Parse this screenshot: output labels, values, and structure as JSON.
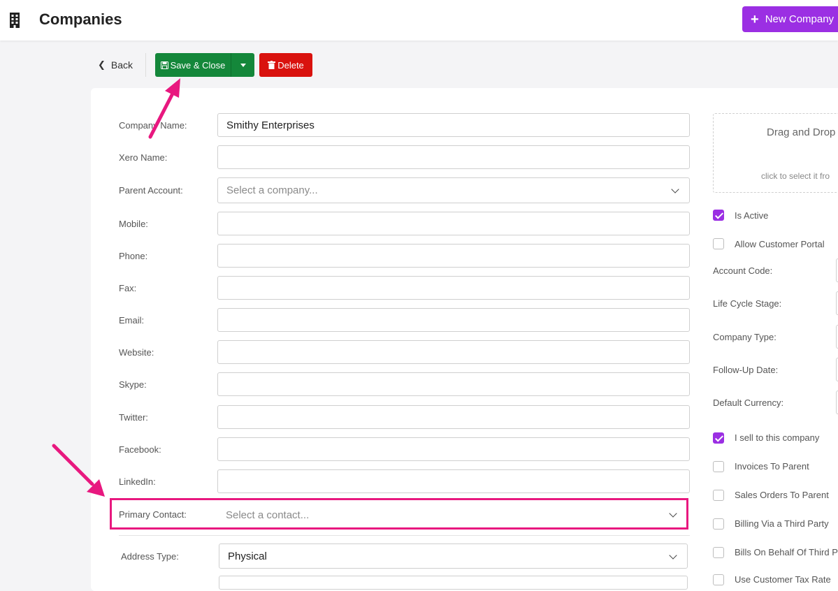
{
  "header": {
    "title": "Companies",
    "new_button_label": "New Company",
    "new_button_icon": "plus-icon",
    "brand_color": "#9b2fe3"
  },
  "toolbar": {
    "back_label": "Back",
    "save_label": "Save & Close",
    "delete_label": "Delete",
    "save_color": "#14873a",
    "delete_color": "#d9120e"
  },
  "form": {
    "company_name": {
      "label": "Company Name:",
      "value": "Smithy Enterprises"
    },
    "xero_name": {
      "label": "Xero Name:",
      "value": ""
    },
    "parent_account": {
      "label": "Parent Account:",
      "placeholder": "Select a company..."
    },
    "mobile": {
      "label": "Mobile:",
      "value": ""
    },
    "phone": {
      "label": "Phone:",
      "value": ""
    },
    "fax": {
      "label": "Fax:",
      "value": ""
    },
    "email": {
      "label": "Email:",
      "value": ""
    },
    "website": {
      "label": "Website:",
      "value": ""
    },
    "skype": {
      "label": "Skype:",
      "value": ""
    },
    "twitter": {
      "label": "Twitter:",
      "value": ""
    },
    "facebook": {
      "label": "Facebook:",
      "value": ""
    },
    "linkedin": {
      "label": "LinkedIn:",
      "value": ""
    },
    "primary_contact": {
      "label": "Primary Contact:",
      "placeholder": "Select a contact..."
    },
    "address_type": {
      "label": "Address Type:",
      "value": "Physical"
    }
  },
  "dropzone": {
    "title": "Drag and Drop",
    "subtitle": "click to select it fro"
  },
  "right_panel": {
    "is_active": {
      "label": "Is Active",
      "checked": true
    },
    "allow_portal": {
      "label": "Allow Customer Portal",
      "checked": false
    },
    "account_code": {
      "label": "Account Code:"
    },
    "life_cycle": {
      "label": "Life Cycle Stage:"
    },
    "company_type": {
      "label": "Company Type:"
    },
    "follow_up": {
      "label": "Follow-Up Date:"
    },
    "currency": {
      "label": "Default Currency:"
    },
    "sell_to": {
      "label": "I sell to this company",
      "checked": true
    },
    "invoices_parent": {
      "label": "Invoices To Parent",
      "checked": false
    },
    "sales_orders_parent": {
      "label": "Sales Orders To Parent",
      "checked": false
    },
    "billing_third": {
      "label": "Billing Via a Third Party",
      "checked": false
    },
    "bills_behalf": {
      "label": "Bills On Behalf Of Third Pa",
      "checked": false
    },
    "use_tax": {
      "label": "Use Customer Tax Rate",
      "checked": false
    }
  },
  "annotations": {
    "arrow_color": "#e8187f"
  }
}
